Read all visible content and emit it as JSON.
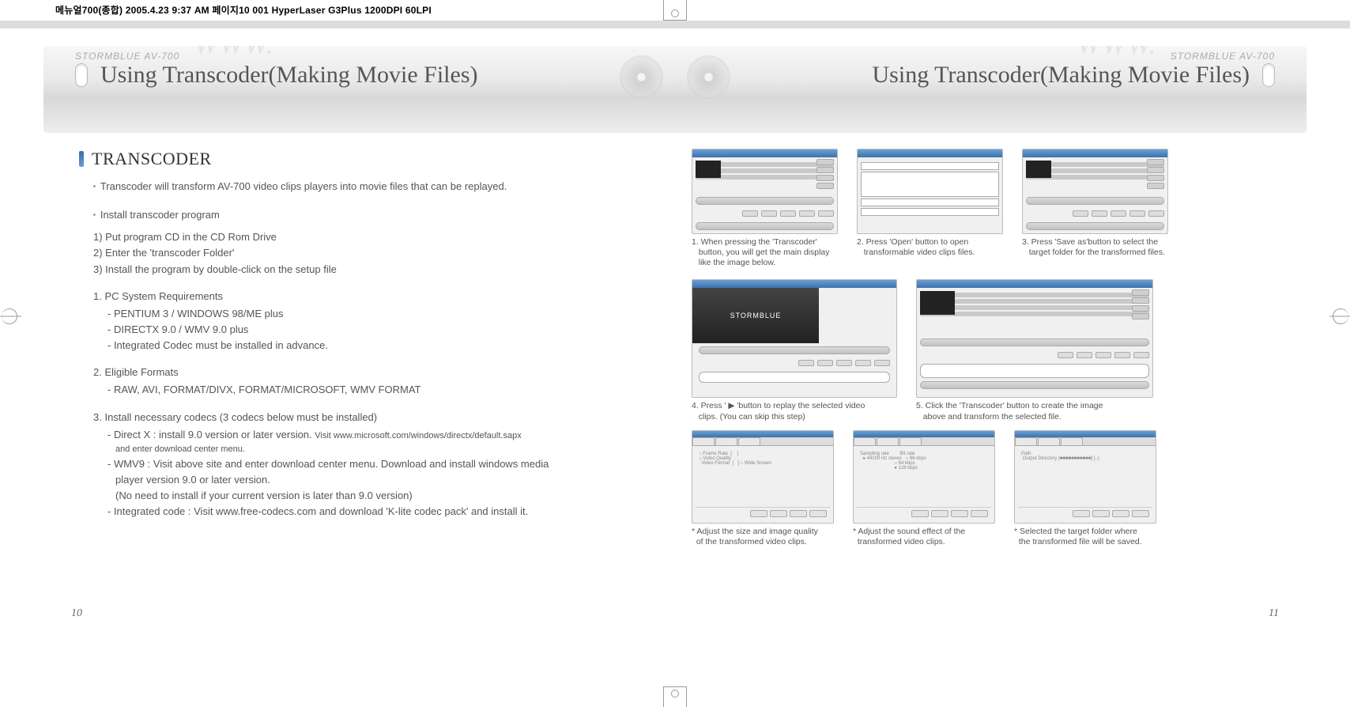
{
  "top_marker": "메뉴얼700(종합)  2005.4.23 9:37 AM 페이지10   001 HyperLaser G3Plus 1200DPI 60LPI",
  "device": "STORMBLUE AV-700",
  "hero_title": "Using Transcoder(Making Movie Files)",
  "section_title": "TRANSCODER",
  "intro": "Transcoder will transform AV-700 video clips players into movie files that can be replayed.",
  "install_head": "Install transcoder program",
  "install_steps": [
    "1) Put program CD in the CD Rom Drive",
    "2) Enter the 'transcoder Folder'",
    "3) Install the program by double-click on the setup file"
  ],
  "sysreq_head": "1. PC System Requirements",
  "sysreq_items": [
    "- PENTIUM 3 / WINDOWS 98/ME plus",
    "- DIRECTX 9.0 / WMV 9.0 plus",
    "- Integrated Codec must be installed in advance."
  ],
  "formats_head": "2. Eligible Formats",
  "formats_items": [
    "- RAW, AVI, FORMAT/DIVX, FORMAT/MICROSOFT, WMV FORMAT"
  ],
  "codecs_head": "3. Install necessary codecs (3 codecs below must be installed)",
  "codecs_items": {
    "dx_a": "- Direct X : install 9.0 version or later version. ",
    "dx_b": "Visit www.microsoft.com/windows/directx/default.sapx",
    "dx_c": "and enter download center menu.",
    "wmv_a": "- WMV9 : Visit above site and enter download center menu. Download and install windows media",
    "wmv_b": "player version 9.0 or later version.",
    "wmv_c": "(No need to install if your current version is later than 9.0 version)",
    "int": "- Integrated code : Visit www.free-codecs.com and download 'K-lite codec pack' and install it."
  },
  "steps": {
    "s1a": "1. When pressing the 'Transcoder'",
    "s1b": "button, you will get the main display",
    "s1c": "like the image below.",
    "s2a": "2. Press 'Open' button to open",
    "s2b": "transformable video clips files.",
    "s3a": "3. Press 'Save as'button to select the",
    "s3b": "target folder for the transformed files.",
    "s4a": "4. Press ' ▶ 'button to replay the selected video",
    "s4b": "clips. (You can skip this step)",
    "s5a": "5. Click the 'Transcoder' button to create the image",
    "s5b": "above and transform the selected file.",
    "c1a": "* Adjust the size and image quality",
    "c1b": "of the transformed video clips.",
    "c2a": "* Adjust the sound effect of the",
    "c2b": "transformed video clips.",
    "c3a": "* Selected the target folder where",
    "c3b": "the transformed file will be saved."
  },
  "video_brand": "STORMBLUE",
  "page_left": "10",
  "page_right": "11"
}
